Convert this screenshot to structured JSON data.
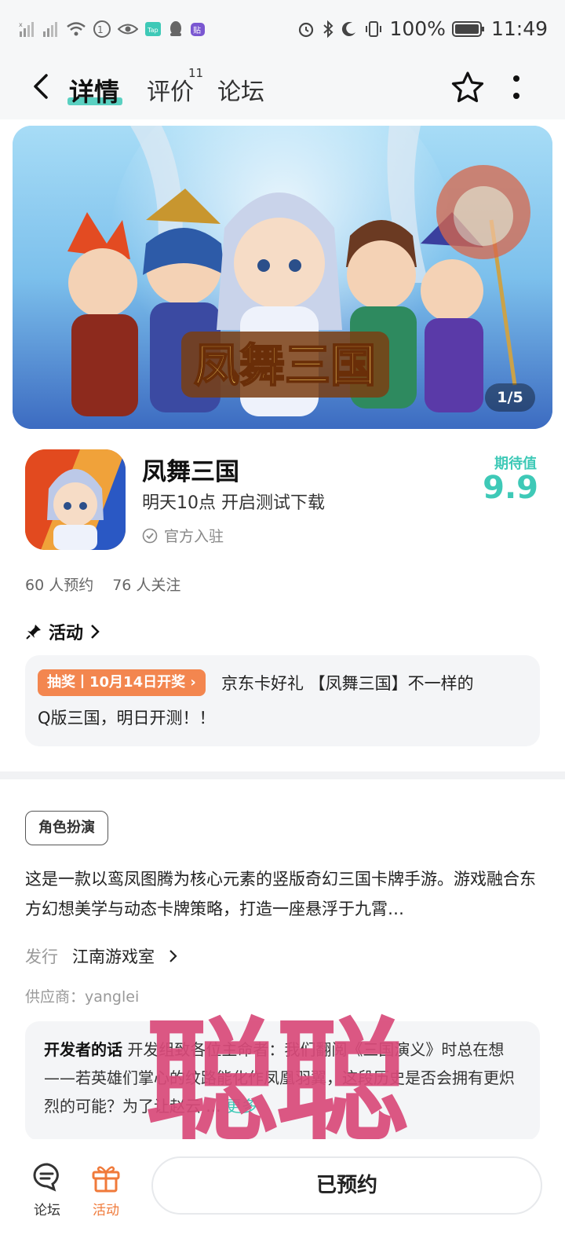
{
  "status_bar": {
    "battery": "100%",
    "time": "11:49",
    "icons": [
      "signal-icon",
      "signal-icon",
      "wifi-icon",
      "nfc-icon",
      "eye-icon",
      "taptap-icon",
      "qq-icon",
      "tieba-icon",
      "alarm-icon",
      "bluetooth-icon",
      "moon-icon",
      "vibrate-icon",
      "battery-icon"
    ]
  },
  "nav": {
    "tabs": [
      {
        "label": "详情",
        "active": true
      },
      {
        "label": "评价",
        "badge": "11"
      },
      {
        "label": "论坛"
      }
    ]
  },
  "banner": {
    "counter": "1/5",
    "art_title": "凤舞三国"
  },
  "app": {
    "name": "凤舞三国",
    "subtitle": "明天10点 开启测试下载",
    "official": "官方入驻",
    "expect_label": "期待值",
    "expect_score": "9.9"
  },
  "stats": {
    "reservations": "60 人预约",
    "followers": "76 人关注"
  },
  "activity": {
    "title": "活动",
    "tag": "抽奖丨10月14日开奖",
    "line1": "京东卡好礼 【凤舞三国】不一样的",
    "line2": "Q版三国，明日开测！！"
  },
  "info": {
    "genre": "角色扮演",
    "description": "这是一款以鸾凤图腾为核心元素的竖版奇幻三国卡牌手游。游戏融合东方幻想美学与动态卡牌策略，打造一座悬浮于九霄…",
    "publisher_label": "发行",
    "publisher": "江南游戏室",
    "supplier": "供应商：yanglei"
  },
  "developer": {
    "title": "开发者的话",
    "text": "开发组致各位主命者：我们翻阅《三国演义》时总在想——若英雄们掌心的纹路能化作凤凰羽翼，这段历史是否会拥有更炽烈的可能？为了让赵云 ...",
    "more": "更多"
  },
  "watermark": "聪聪",
  "bottom": {
    "forum": "论坛",
    "activity": "活动",
    "reserve": "已预约"
  },
  "colors": {
    "accent": "#3ec9b7",
    "orange": "#f3864f",
    "watermark": "#d94a7a"
  }
}
